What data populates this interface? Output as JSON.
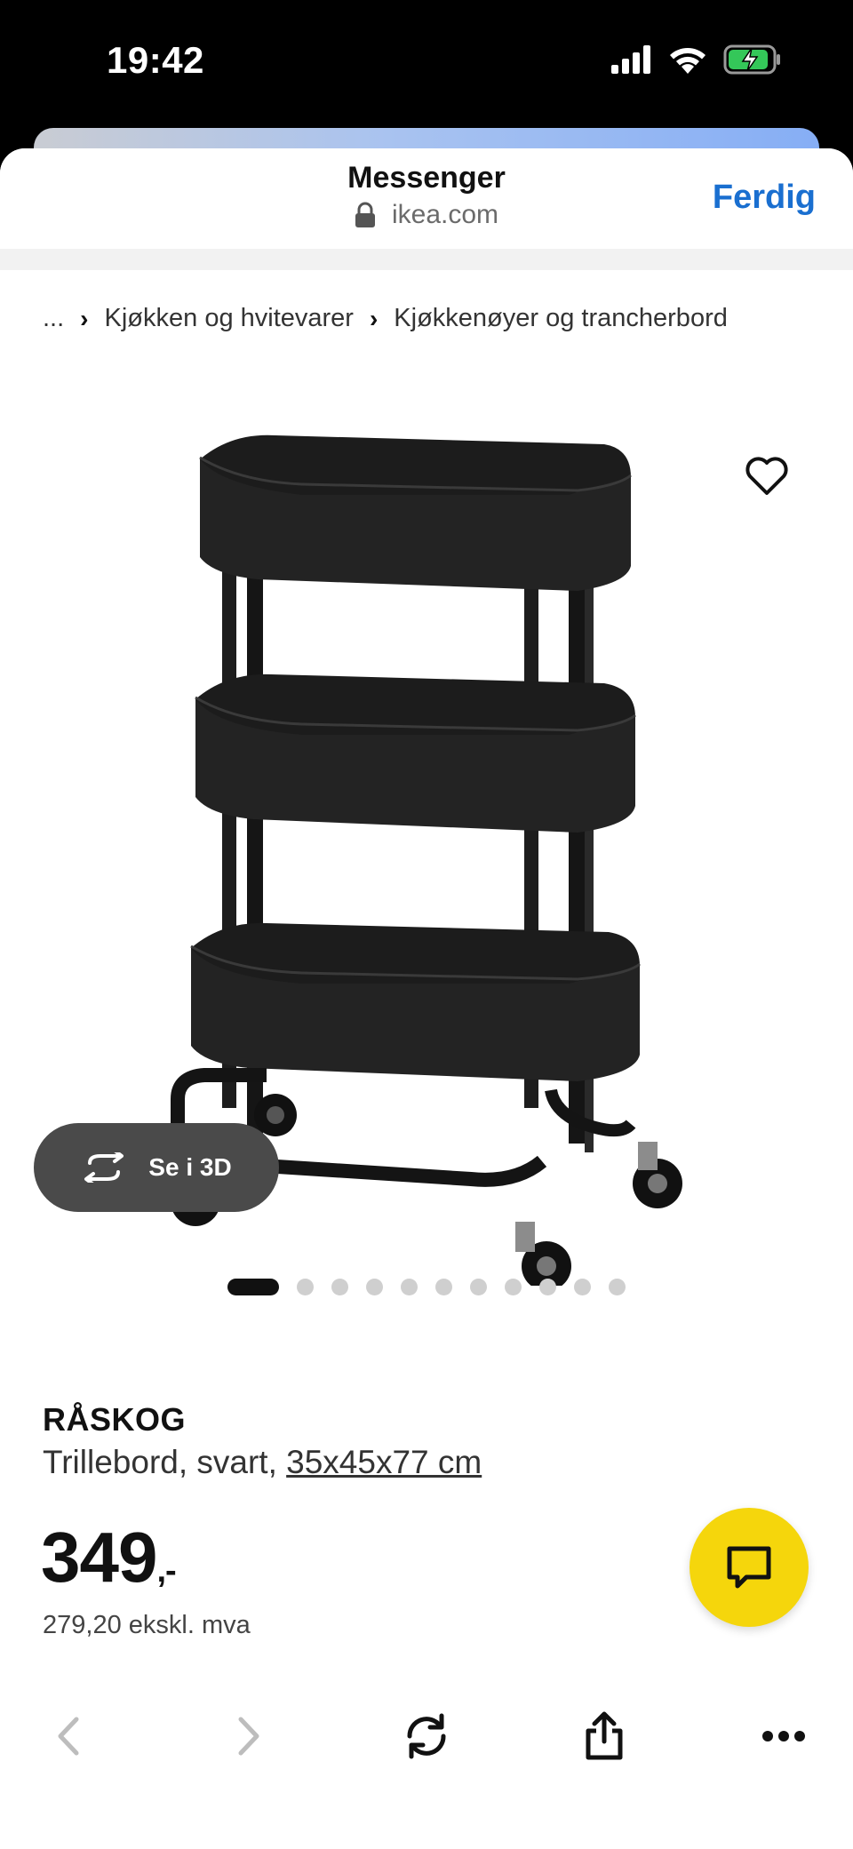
{
  "status_bar": {
    "time": "19:42"
  },
  "sheet": {
    "title": "Messenger",
    "url": "ikea.com",
    "done_label": "Ferdig"
  },
  "breadcrumb": {
    "ellipsis": "...",
    "items": [
      "Kjøkken og hvitevarer",
      "Kjøkkenøyer og trancherbord"
    ]
  },
  "media": {
    "view_3d_label": "Se i 3D",
    "dot_count": 11,
    "active_dot": 0
  },
  "product": {
    "name": "RÅSKOG",
    "description": "Trillebord, svart, ",
    "dimensions": "35x45x77 cm",
    "price_main": "349",
    "price_suffix": ",-",
    "price_ex_vat": "279,20 ekskl. mva"
  },
  "colors": {
    "link_blue": "#1a6fd0",
    "chat_yellow": "#f5d60c",
    "pill_gray": "#4a4a4a"
  }
}
